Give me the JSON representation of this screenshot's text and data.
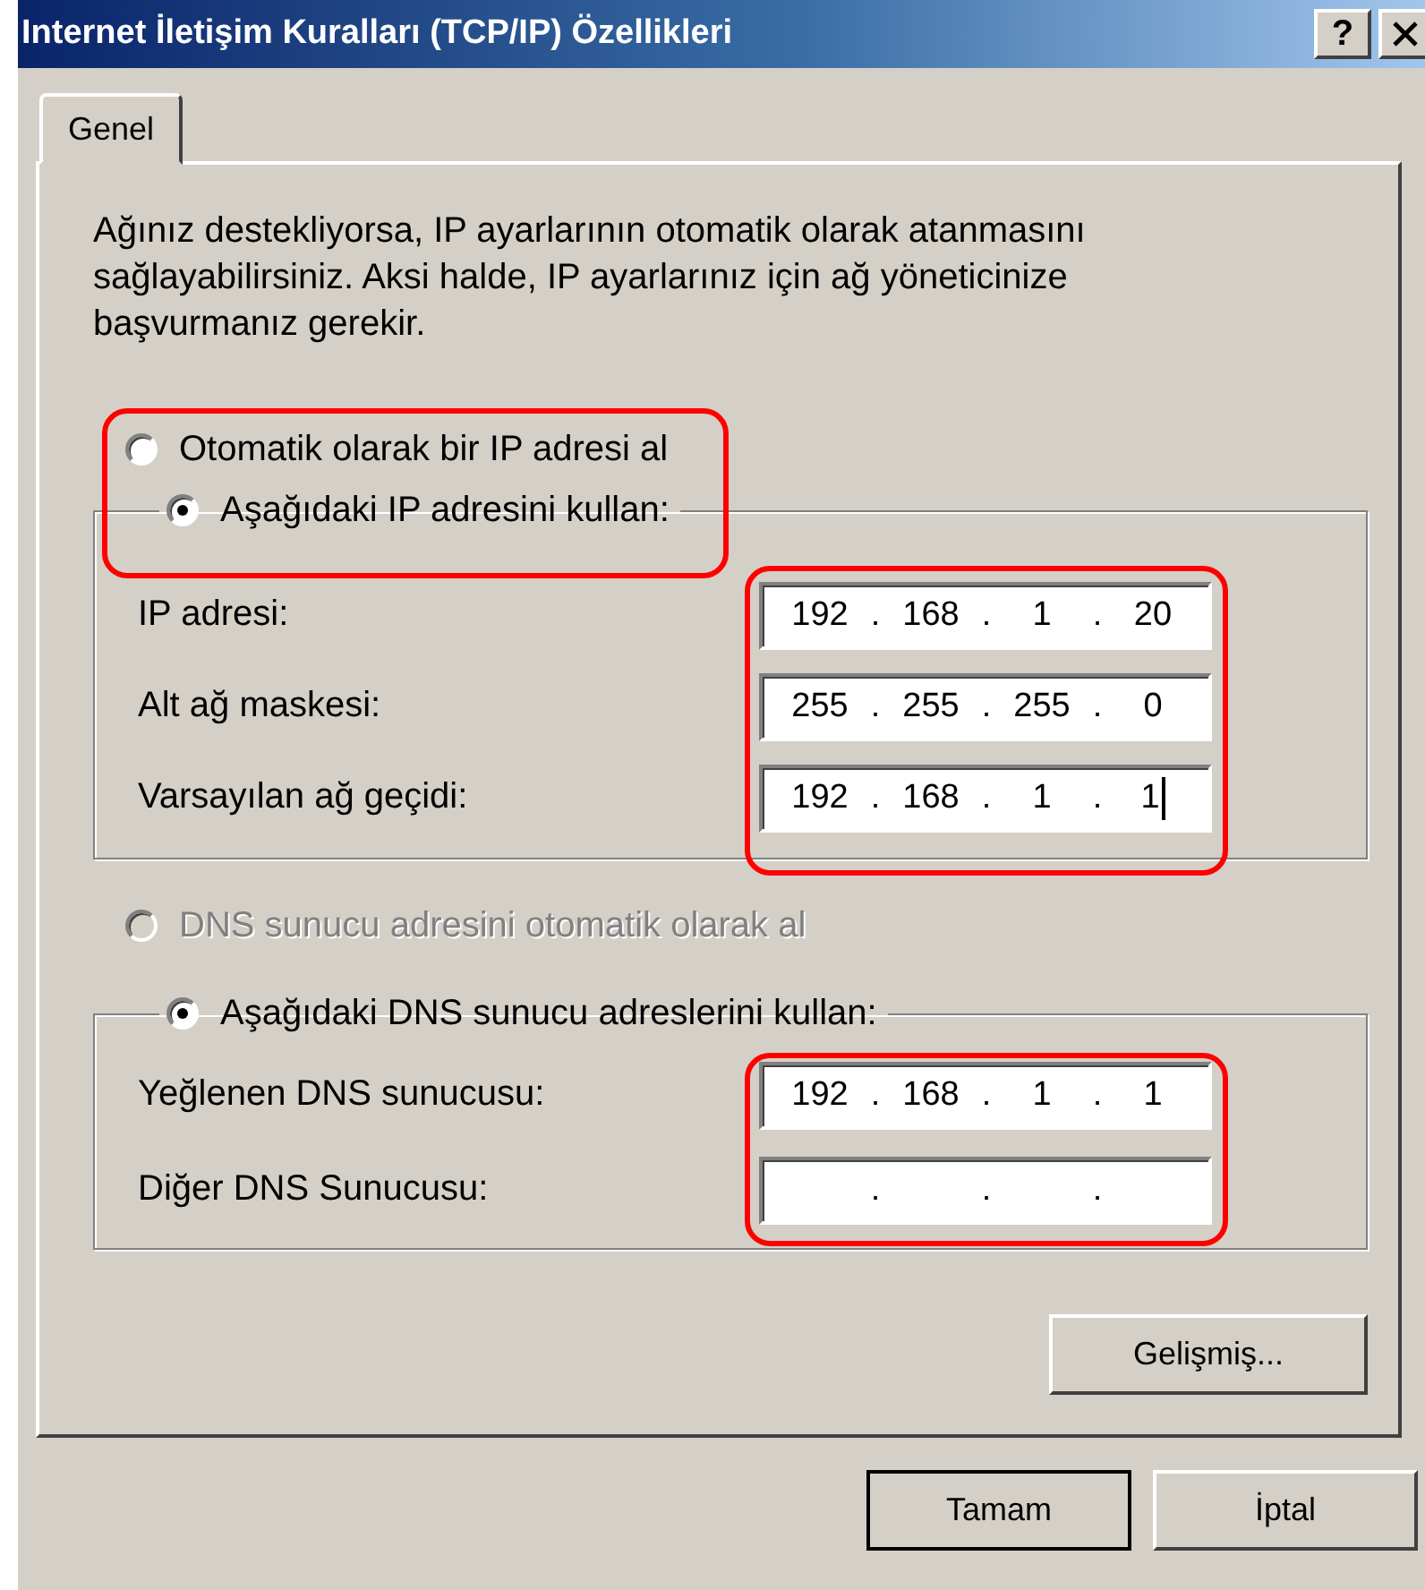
{
  "window": {
    "title": "Internet İletişim Kuralları (TCP/IP) Özellikleri",
    "help_button": "?"
  },
  "tabs": [
    {
      "label": "Genel",
      "selected": true
    }
  ],
  "description": "Ağınız destekliyorsa, IP ayarlarının otomatik olarak atanmasını sağlayabilirsiniz. Aksi halde, IP ayarlarınız için ağ yöneticinize başvurmanız gerekir.",
  "ip": {
    "highlighted": true,
    "radios": [
      {
        "label": "Otomatik olarak bir IP adresi al",
        "selected": false,
        "disabled": false
      },
      {
        "label": "Aşağıdaki IP adresini kullan:",
        "selected": true,
        "disabled": false
      }
    ],
    "fields_highlighted": true,
    "fields": [
      {
        "label": "IP adresi:",
        "octets": [
          "192",
          "168",
          "1",
          "20"
        ],
        "dots": [
          ".",
          ".",
          "."
        ],
        "focused": false
      },
      {
        "label": "Alt ağ maskesi:",
        "octets": [
          "255",
          "255",
          "255",
          "0"
        ],
        "dots": [
          ".",
          ".",
          "."
        ],
        "focused": false
      },
      {
        "label": "Varsayılan ağ geçidi:",
        "octets": [
          "192",
          "168",
          "1",
          "1"
        ],
        "dots": [
          ".",
          ".",
          "."
        ],
        "focused": true
      }
    ]
  },
  "dns": {
    "radios": [
      {
        "label": "DNS sunucu adresini otomatik olarak al",
        "selected": false,
        "disabled": true
      },
      {
        "label": "Aşağıdaki DNS sunucu adreslerini kullan:",
        "selected": true,
        "disabled": false
      }
    ],
    "fields_highlighted": true,
    "fields": [
      {
        "label": "Yeğlenen DNS sunucusu:",
        "octets": [
          "192",
          "168",
          "1",
          "1"
        ],
        "dots": [
          ".",
          ".",
          "."
        ],
        "focused": false
      },
      {
        "label": "Diğer DNS Sunucusu:",
        "dots": [
          ".",
          ".",
          "."
        ],
        "focused": false
      }
    ]
  },
  "advanced_button": "Gelişmiş...",
  "buttons": [
    "Tamam",
    "İptal"
  ]
}
